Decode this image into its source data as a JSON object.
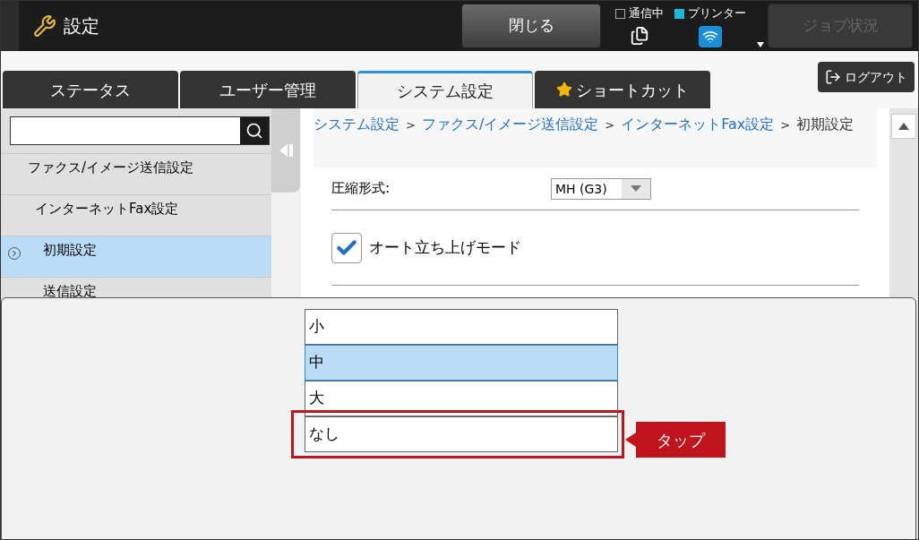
{
  "header": {
    "title": "設定",
    "close_button": "閉じる",
    "indicators": [
      {
        "label": "通信中",
        "on": false
      },
      {
        "label": "プリンター",
        "on": true
      }
    ],
    "job_status": {
      "label": "ジョブ状況",
      "disabled": true
    }
  },
  "logout": "ログアウト",
  "tabs": [
    {
      "label": "ステータス",
      "selected": false,
      "kind": "plain"
    },
    {
      "label": "ユーザー管理",
      "selected": false,
      "kind": "plain"
    },
    {
      "label": "システム設定",
      "selected": true,
      "kind": "plain"
    },
    {
      "label": "ショートカット",
      "selected": false,
      "kind": "star"
    }
  ],
  "sidebar": {
    "items": [
      {
        "label": "ファクス/イメージ送信設定",
        "selected": false,
        "children": [
          {
            "label": "インターネットFax設定",
            "selected": false,
            "children": [
              {
                "label": "初期設定",
                "selected": true
              },
              {
                "label": "送信設定",
                "selected": false
              }
            ]
          }
        ]
      }
    ]
  },
  "breadcrumb": [
    {
      "label": "システム設定",
      "kind": "link"
    },
    {
      "label": ">",
      "kind": "separator"
    },
    {
      "label": "ファクス/イメージ送信設定",
      "kind": "link"
    },
    {
      "label": ">",
      "kind": "separator"
    },
    {
      "label": "インターネットFax設定",
      "kind": "link"
    },
    {
      "label": ">",
      "kind": "separator"
    },
    {
      "label": "初期設定",
      "kind": "current"
    }
  ],
  "settings": [
    {
      "kind": "select",
      "label": "圧縮形式:",
      "value": "MH (G3)"
    },
    {
      "kind": "checkbox",
      "label": "オート立ち上げモード",
      "checked": true
    }
  ],
  "popup": {
    "options": [
      {
        "label": "小",
        "selected": false,
        "highlighted": false
      },
      {
        "label": "中",
        "selected": true,
        "highlighted": false
      },
      {
        "label": "大",
        "selected": false,
        "highlighted": false
      },
      {
        "label": "なし",
        "selected": false,
        "highlighted": true
      }
    ],
    "callout": "タップ"
  }
}
